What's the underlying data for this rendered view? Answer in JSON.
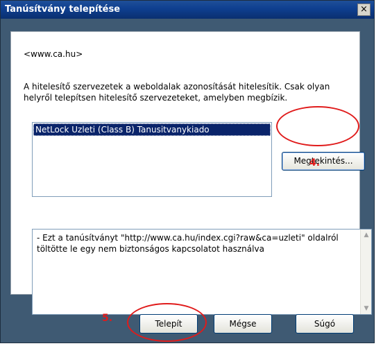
{
  "window": {
    "title": "Tanúsítvány telepítése",
    "close_label": "×"
  },
  "content": {
    "site": "<www.ca.hu>",
    "description": "A hitelesítő szervezetek a weboldalak azonosítását hitelesítik. Csak olyan helyről telepítsen hitelesítő szervezeteket, amelyben megbízik.",
    "certificates": [
      {
        "label": "NetLock Uzleti (Class B) Tanusitvanykiado",
        "selected": true
      }
    ],
    "view_button": "Megtekintés...",
    "details": "- Ezt a tanúsítványt \"http://www.ca.hu/index.cgi?raw&ca=uzleti\" oldalról töltötte le egy nem biztonságos kapcsolatot használva"
  },
  "buttons": {
    "install": "Telepít",
    "cancel": "Mégse",
    "help": "Súgó"
  },
  "annotations": {
    "step4": "4.",
    "step5": "5.",
    "color": "#e01b1b"
  },
  "icons": {
    "scroll_up": "▲",
    "scroll_down": "▼"
  }
}
